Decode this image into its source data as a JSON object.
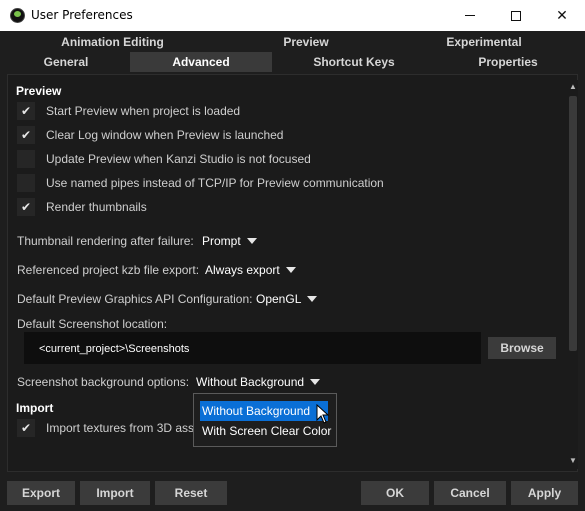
{
  "window": {
    "title": "User Preferences"
  },
  "tabs": {
    "row1": [
      {
        "label": "Animation Editing",
        "active": false
      },
      {
        "label": "Preview",
        "active": false
      },
      {
        "label": "Experimental",
        "active": false
      }
    ],
    "row2": [
      {
        "label": "General",
        "active": false
      },
      {
        "label": "Advanced",
        "active": true
      },
      {
        "label": "Shortcut Keys",
        "active": false
      },
      {
        "label": "Properties",
        "active": false
      }
    ]
  },
  "preview": {
    "heading": "Preview",
    "checkboxes": [
      {
        "label": "Start Preview when project is loaded",
        "checked": true
      },
      {
        "label": "Clear Log window when Preview is launched",
        "checked": true
      },
      {
        "label": "Update Preview when Kanzi Studio is not focused",
        "checked": false
      },
      {
        "label": "Use named pipes instead of TCP/IP for Preview communication",
        "checked": false
      },
      {
        "label": "Render thumbnails",
        "checked": true
      }
    ],
    "thumbnail_failure": {
      "label": "Thumbnail rendering after failure:",
      "value": "Prompt"
    },
    "kzb_export": {
      "label": "Referenced project kzb file export:",
      "value": "Always export"
    },
    "graphics_api": {
      "label": "Default Preview Graphics API Configuration:",
      "value": "OpenGL"
    },
    "screenshot_location": {
      "label": "Default Screenshot location:",
      "value": "<current_project>\\Screenshots",
      "browse_label": "Browse"
    },
    "screenshot_background": {
      "label": "Screenshot background options:",
      "value": "Without Background",
      "options": [
        "Without Background",
        "With Screen Clear Color"
      ],
      "highlighted_option": "Without Background"
    }
  },
  "import": {
    "heading": "Import",
    "checkboxes": [
      {
        "label": "Import textures from 3D ass",
        "checked": true
      }
    ]
  },
  "footer": {
    "export_label": "Export",
    "import_label": "Import",
    "reset_label": "Reset",
    "ok_label": "OK",
    "cancel_label": "Cancel",
    "apply_label": "Apply"
  },
  "colors": {
    "accent": "#0a6fd6",
    "background": "#1e1e1e",
    "button": "#3b3b3b"
  }
}
